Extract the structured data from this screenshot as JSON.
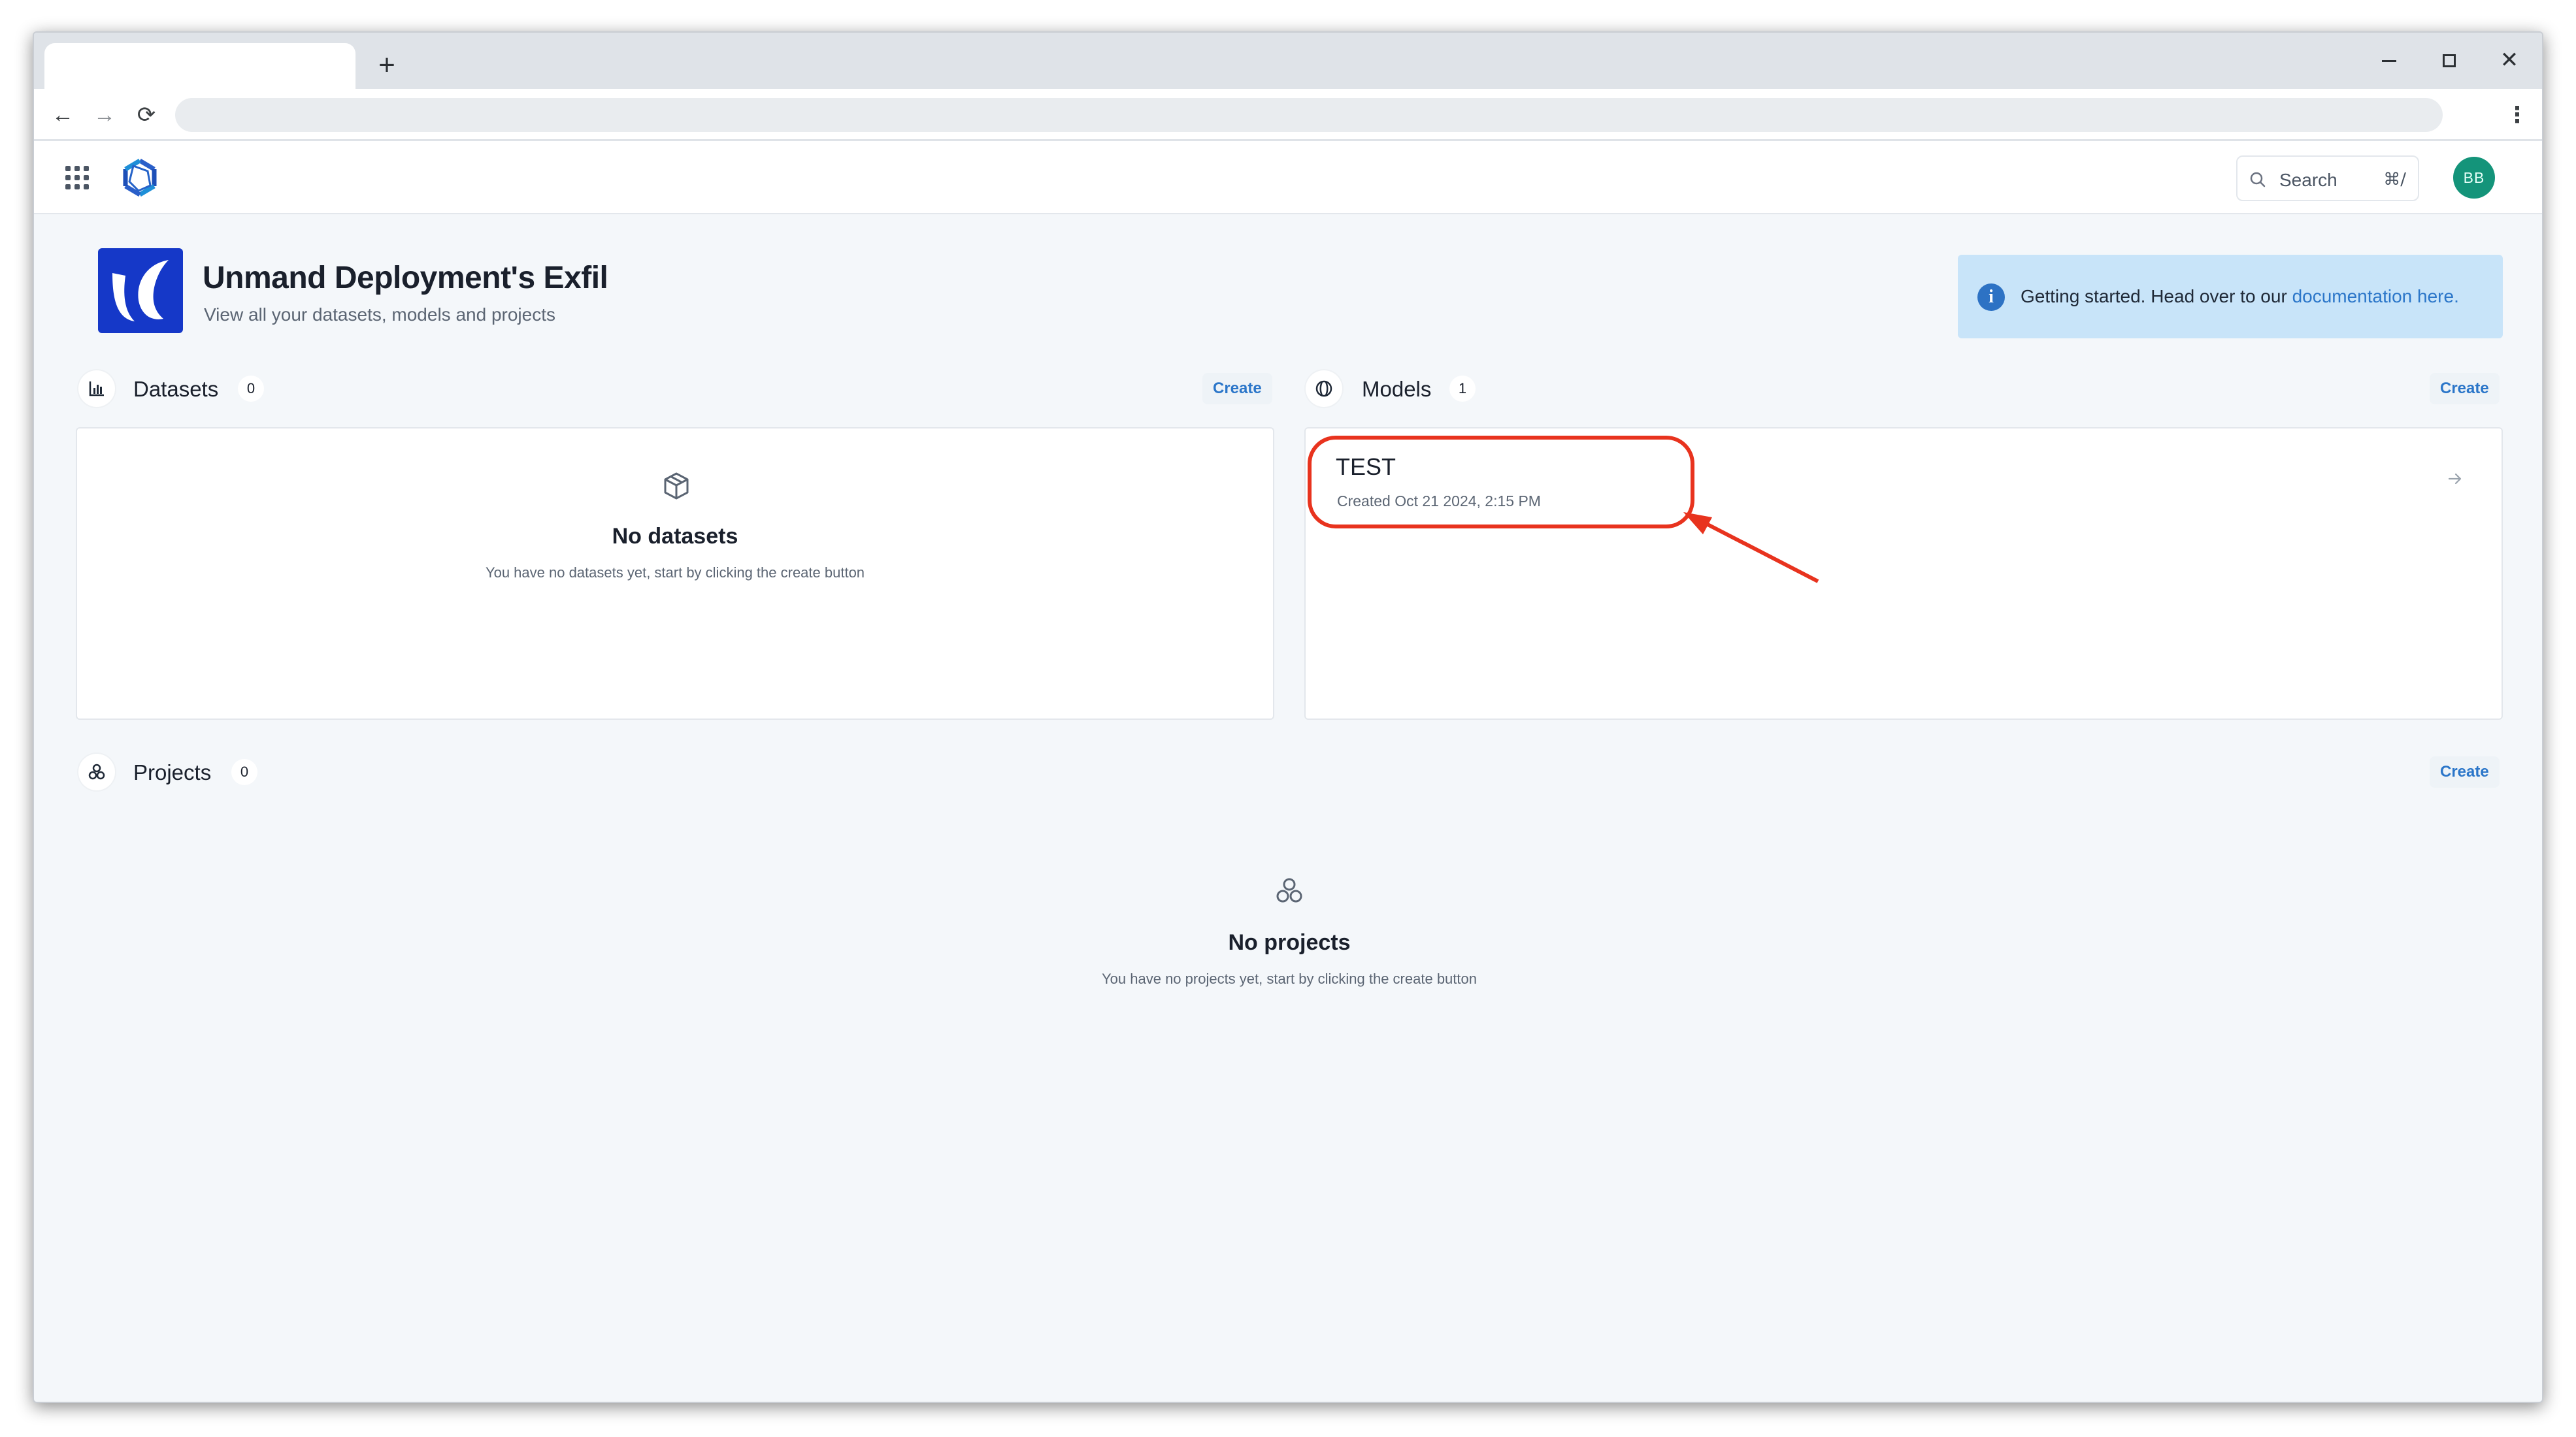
{
  "browser": {
    "new_tab_label": "+",
    "back_icon": "←",
    "forward_icon": "→",
    "reload_icon": "⟳",
    "menu_icon": "⋮",
    "minimize_label": "",
    "maximize_label": "",
    "close_label": "✕"
  },
  "header": {
    "search_label": "Search",
    "search_shortcut": "⌘/",
    "avatar_initials": "BB"
  },
  "org": {
    "title": "Unmand Deployment's Exfil",
    "subtitle": "View all your datasets, models and projects"
  },
  "banner": {
    "icon": "i",
    "text": "Getting started. Head over to our ",
    "link": "documentation here."
  },
  "datasets": {
    "title": "Datasets",
    "count": "0",
    "create_label": "Create",
    "empty_title": "No datasets",
    "empty_subtitle": "You have no datasets yet, start by clicking the create button"
  },
  "models": {
    "title": "Models",
    "count": "1",
    "create_label": "Create",
    "items": [
      {
        "name": "TEST",
        "created": "Created Oct 21 2024, 2:15 PM"
      }
    ]
  },
  "projects": {
    "title": "Projects",
    "count": "0",
    "create_label": "Create",
    "empty_title": "No projects",
    "empty_subtitle": "You have no projects yet, start by clicking the create button"
  },
  "colors": {
    "accent": "#2b76c9",
    "brand": "#1538c8",
    "avatar": "#14947a",
    "banner": "#c8e4f9",
    "annotation": "#e8331e"
  }
}
